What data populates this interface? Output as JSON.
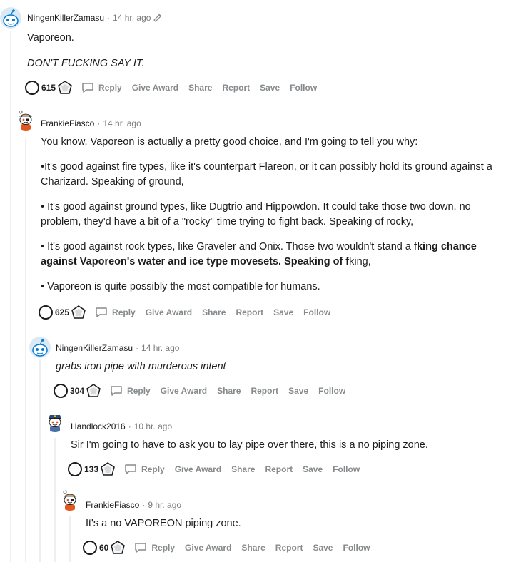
{
  "comments": [
    {
      "username": "NingenKillerZamasu",
      "time": "14 hr. ago",
      "avatar_icon": "snoo-blue-avatar-icon",
      "paragraphs": [
        {
          "text": "Vaporeon.",
          "style": "normal"
        },
        {
          "text": "DON'T FUCKING SAY IT.",
          "style": "italic"
        }
      ],
      "score": "615"
    },
    {
      "username": "FrankieFiasco",
      "time": "14 hr. ago",
      "avatar_icon": "snoo-pirate-avatar-icon",
      "paragraphs": [
        {
          "text": "You know, Vaporeon is actually a pretty good choice, and I'm going to tell you why:"
        },
        {
          "text": "•It's good against fire types, like it's counterpart Flareon, or it can possibly hold its ground against a Charizard. Speaking of ground,"
        },
        {
          "text": "• It's good against ground types, like Dugtrio and Hippowdon. It could take those two down, no problem, they'd have a bit of a \"rocky\" time trying to fight back. Speaking of rocky,"
        },
        {
          "a": "• It's good against rock types, like Graveler and Onix. Those two wouldn't stand a f",
          "b": "king chance against Vaporeon's water and ice type movesets. Speaking of f",
          "c": "king,"
        },
        {
          "text": "• Vaporeon is quite possibly the most compatible for humans."
        }
      ],
      "score": "625"
    },
    {
      "username": "NingenKillerZamasu",
      "time": "14 hr. ago",
      "avatar_icon": "snoo-blue-avatar-icon",
      "paragraphs": [
        {
          "text": "grabs iron pipe with murderous intent",
          "style": "italic"
        }
      ],
      "score": "304"
    },
    {
      "username": "Handlock2016",
      "time": "10 hr. ago",
      "avatar_icon": "snoo-police-avatar-icon",
      "paragraphs": [
        {
          "text": "Sir I'm going to have to ask you to lay pipe over there, this is a no piping zone."
        }
      ],
      "score": "133"
    },
    {
      "username": "FrankieFiasco",
      "time": "9 hr. ago",
      "avatar_icon": "snoo-pirate-avatar-icon",
      "paragraphs": [
        {
          "text": "It's a no VAPOREON piping zone."
        }
      ],
      "score": "60"
    }
  ],
  "actions": {
    "reply": "Reply",
    "give_award": "Give Award",
    "share": "Share",
    "report": "Report",
    "save": "Save",
    "follow": "Follow"
  },
  "separator": "·",
  "colors": {
    "text": "#1c1c1c",
    "meta": "#7c7c7c",
    "action": "#878a8c",
    "thread_line": "#edeff1",
    "snoo_blue": "#0079d3"
  }
}
